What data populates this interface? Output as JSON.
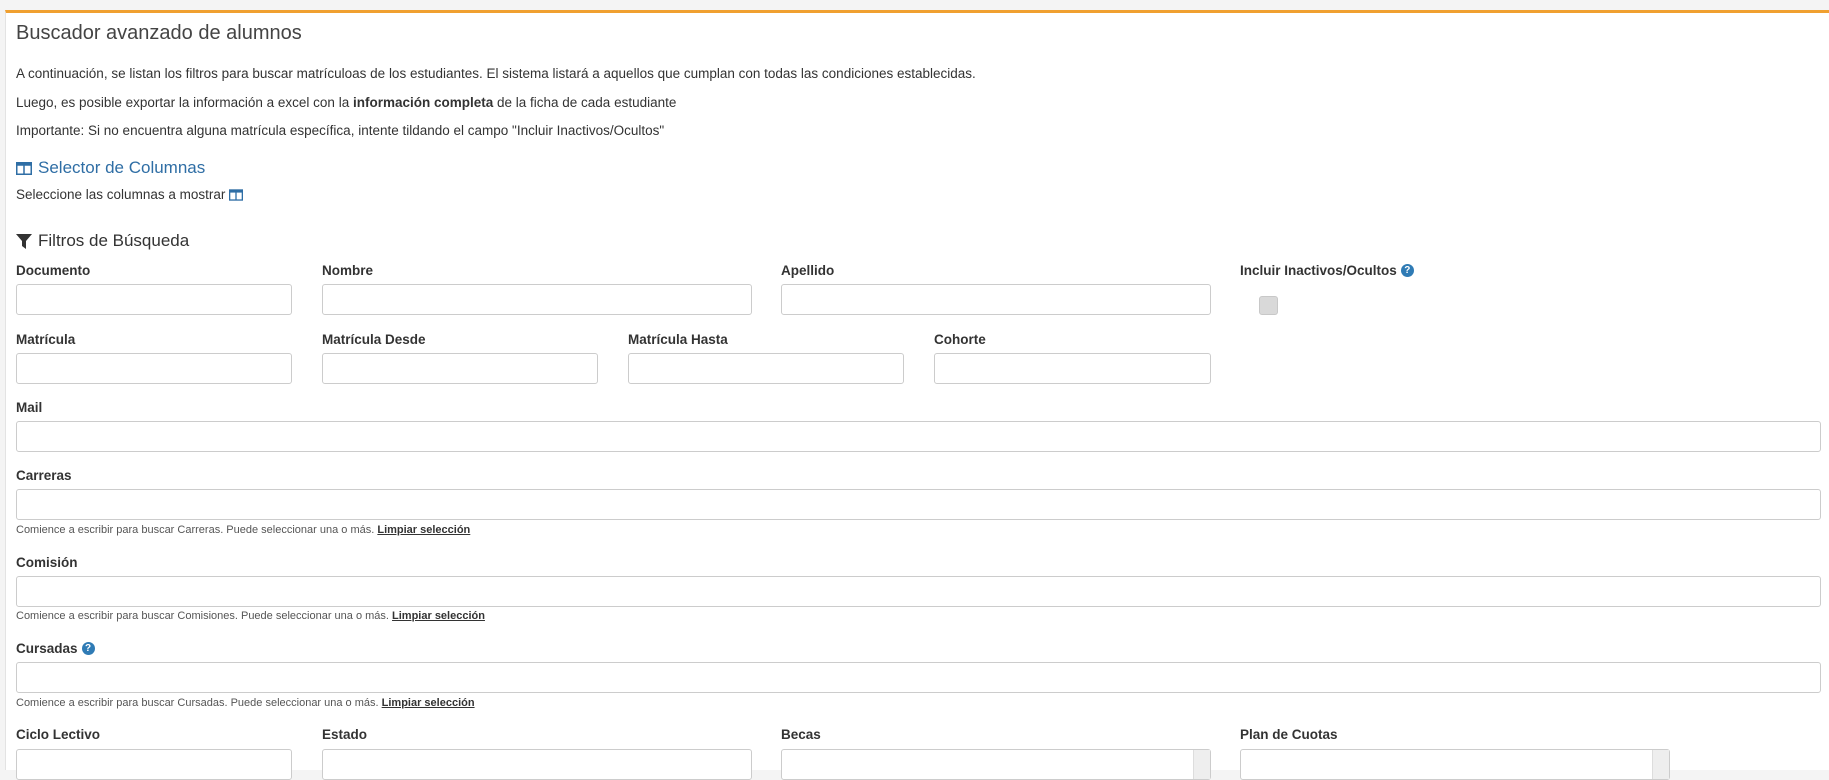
{
  "header": {
    "title": "Buscador avanzado de alumnos"
  },
  "intro": {
    "line1": "A continuación, se listan los filtros para buscar matrículoas de los estudiantes. El sistema listará a aquellos que cumplan con todas las condiciones establecidas.",
    "line2_before": "Luego, es posible exportar la información a excel con la ",
    "line2_bold": "información completa",
    "line2_after": " de la ficha de cada estudiante",
    "line3": "Importante: Si no encuentra alguna matrícula específica, intente tildando el campo \"Incluir Inactivos/Ocultos\""
  },
  "column_selector": {
    "title": "Selector de Columnas",
    "description": "Seleccione las columnas a mostrar",
    "icon": "columns-icon",
    "color": "#2f6ea5"
  },
  "filters": {
    "title": "Filtros de Búsqueda",
    "icon": "filter-icon",
    "documento": {
      "label": "Documento",
      "value": ""
    },
    "nombre": {
      "label": "Nombre",
      "value": ""
    },
    "apellido": {
      "label": "Apellido",
      "value": ""
    },
    "incluir_inactivos": {
      "label": "Incluir Inactivos/Ocultos",
      "checked": false
    },
    "matricula": {
      "label": "Matrícula",
      "value": ""
    },
    "matricula_desde": {
      "label": "Matrícula Desde",
      "value": ""
    },
    "matricula_hasta": {
      "label": "Matrícula Hasta",
      "value": ""
    },
    "cohorte": {
      "label": "Cohorte",
      "value": ""
    },
    "mail": {
      "label": "Mail",
      "value": ""
    },
    "carreras": {
      "label": "Carreras",
      "value": "",
      "help": "Comience a escribir para buscar Carreras. Puede seleccionar una o más.",
      "clear": "Limpiar selección"
    },
    "comision": {
      "label": "Comisión",
      "value": "",
      "help": "Comience a escribir para buscar Comisiones. Puede seleccionar una o más.",
      "clear": "Limpiar selección"
    },
    "cursadas": {
      "label": "Cursadas",
      "value": "",
      "help": "Comience a escribir para buscar Cursadas. Puede seleccionar una o más.",
      "clear": "Limpiar selección"
    },
    "ciclo_lectivo": {
      "label": "Ciclo Lectivo"
    },
    "estado": {
      "label": "Estado"
    },
    "becas": {
      "label": "Becas"
    },
    "plan_cuotas": {
      "label": "Plan de Cuotas"
    }
  },
  "colors": {
    "accent_top": "#f0a030",
    "link": "#2f6ea5",
    "help_badge": "#2f7bb5"
  }
}
